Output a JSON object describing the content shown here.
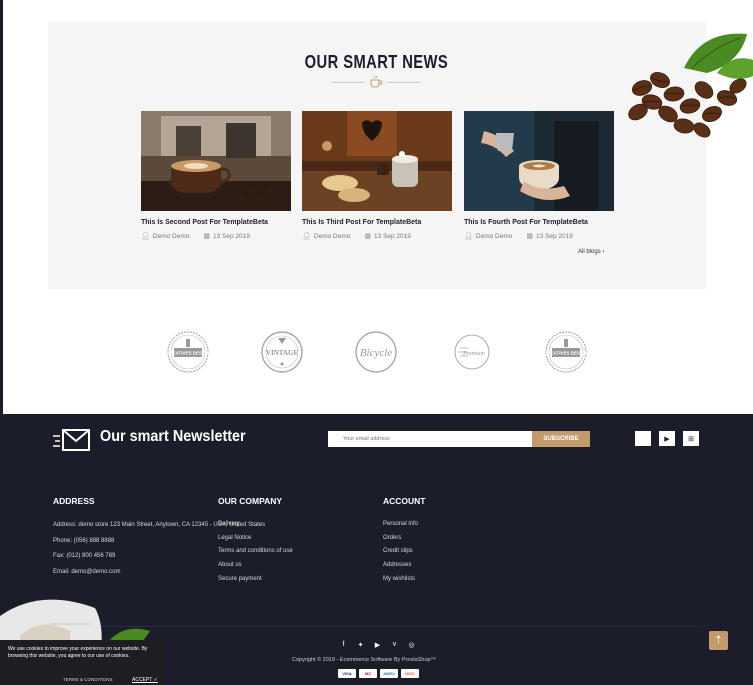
{
  "news": {
    "title": "OUR SMART NEWS",
    "posts": [
      {
        "title": "This Is Second Post For TemplateBeta",
        "author": "Demo Demo",
        "date": "13 Sep 2019"
      },
      {
        "title": "This Is Third Post For TemplateBeta",
        "author": "Demo Demo",
        "date": "13 Sep 2019"
      },
      {
        "title": "This Is Fourth Post For TemplateBeta",
        "author": "Demo Demo",
        "date": "13 Sep 2019"
      }
    ],
    "all_blogs": "All blogs ›"
  },
  "brands": {
    "creatives_design": "CREATIVES DESIGN",
    "vintage": "VINTAGE",
    "bicycle": "Bicycle",
    "premium": "Premium"
  },
  "newsletter": {
    "title": "Our smart Newsletter",
    "placeholder": "Your email address",
    "button": "SUBSCRIBE"
  },
  "footer": {
    "address": {
      "heading": "ADDRESS",
      "lines": [
        "Address: demo store 123 Main Street, Anytown, CA 12345 - USA, United States",
        "Phone: (056) 888 8888",
        "Fax: (012) 800 456 789",
        "Email: demo@demo.com"
      ]
    },
    "company": {
      "heading": "OUR COMPANY",
      "links": [
        "Delivery",
        "Legal Notice",
        "Terms and conditions of use",
        "About us",
        "Secure payment"
      ]
    },
    "account": {
      "heading": "ACCOUNT",
      "links": [
        "Personal info",
        "Orders",
        "Credit slips",
        "Addresses",
        "My wishlists"
      ]
    },
    "copyright": "Copyright © 2019 - Ecommerce Software By PrestaShop™",
    "payments": [
      "VISA",
      "MC",
      "AMEX",
      "DISC"
    ]
  },
  "cookie": {
    "text": "We use cookies to improve your experience on our website. By browsing this website, you agree to our use of cookies.",
    "terms": "TERMS & CONDITIONS",
    "accept": "ACCEPT ✓"
  },
  "colors": {
    "footer_bg": "#1c1d2b",
    "accent": "#c49a6c"
  }
}
